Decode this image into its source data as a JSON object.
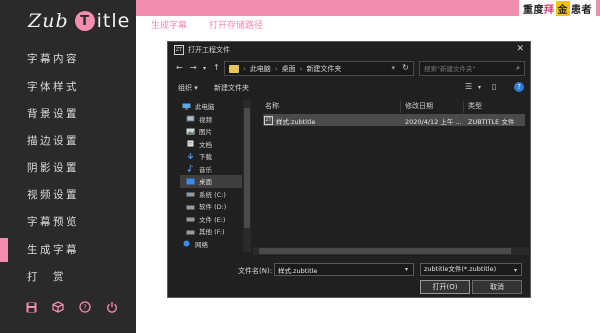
{
  "app": {
    "logo_left": "Zub",
    "logo_circle": "T",
    "logo_right": "itle"
  },
  "sidebar": {
    "items": [
      {
        "label": "字幕内容"
      },
      {
        "label": "字体样式"
      },
      {
        "label": "背景设置"
      },
      {
        "label": "描边设置"
      },
      {
        "label": "阴影设置"
      },
      {
        "label": "视频设置"
      },
      {
        "label": "字幕预览"
      },
      {
        "label": "生成字幕",
        "active": true
      },
      {
        "label": "打　赏"
      }
    ],
    "bottom_icons": [
      "save-icon",
      "cube-icon",
      "help-icon",
      "power-icon"
    ]
  },
  "topbar": {
    "accent": "#f38db0",
    "tabs": [
      "生成字幕",
      "打开存储路径"
    ],
    "banner": {
      "part1": "重度",
      "part2": "拜",
      "part3": "金",
      "part4": "患者"
    }
  },
  "dialog": {
    "title": "打开工程文件",
    "app_icon_text": "ZT",
    "breadcrumbs": [
      "此电脑",
      "桌面",
      "新建文件夹"
    ],
    "search_placeholder": "搜索\"新建文件夹\"",
    "commands": {
      "organize": "组织 ▾",
      "new_folder": "新建文件夹"
    },
    "tree": [
      {
        "label": "此电脑",
        "icon": "computer-icon"
      },
      {
        "label": "视频",
        "icon": "video-icon"
      },
      {
        "label": "图片",
        "icon": "picture-icon"
      },
      {
        "label": "文档",
        "icon": "document-icon"
      },
      {
        "label": "下载",
        "icon": "download-icon"
      },
      {
        "label": "音乐",
        "icon": "music-icon"
      },
      {
        "label": "桌面",
        "icon": "desktop-icon",
        "selected": true
      },
      {
        "label": "系统 (C:)",
        "icon": "drive-icon"
      },
      {
        "label": "软件 (D:)",
        "icon": "drive-icon"
      },
      {
        "label": "文件 (E:)",
        "icon": "drive-icon"
      },
      {
        "label": "其他 (F:)",
        "icon": "drive-icon"
      },
      {
        "label": "网络",
        "icon": "network-icon"
      }
    ],
    "columns": {
      "name": "名称",
      "date": "修改日期",
      "type": "类型"
    },
    "files": [
      {
        "name": "样式.zubtitle",
        "date": "2020/4/12 上午 ...",
        "type": "ZUBTITLE 文件"
      }
    ],
    "filename_label": "文件名(N):",
    "filename_value": "样式.zubtitle",
    "filetype": "zubtitle文件(*.zubtitle)",
    "open_button": "打开(O)",
    "cancel_button": "取消"
  }
}
